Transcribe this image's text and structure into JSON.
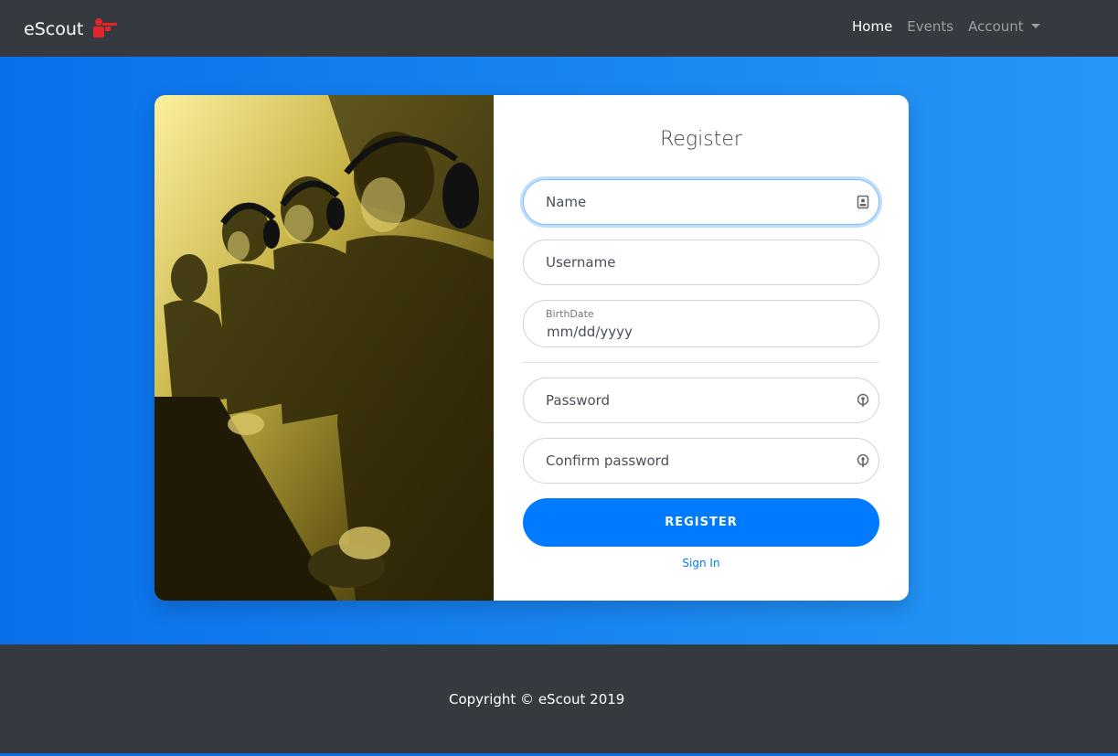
{
  "navbar": {
    "brand": "eScout",
    "links": [
      {
        "label": "Home"
      },
      {
        "label": "Events"
      },
      {
        "label": "Account"
      }
    ]
  },
  "form": {
    "title": "Register",
    "name_placeholder": "Name",
    "username_placeholder": "Username",
    "birthdate_label": "BirthDate",
    "birthdate_value": "mm/dd/yyyy",
    "password_placeholder": "Password",
    "confirm_placeholder": "Confirm password",
    "register_label": "REGISTER",
    "signin_label": "Sign In"
  },
  "footer": {
    "copyright": "Copyright © eScout 2019"
  },
  "colors": {
    "navbar_bg": "#343a40",
    "primary": "#007bff",
    "gradient_start": "#0a70ea",
    "gradient_end": "#2797f7",
    "logo_red": "#e0262b"
  },
  "icons": {
    "brand_logo": "gamer-icon",
    "name_field": "contact-card-icon",
    "password_field": "key-icon",
    "account_dropdown": "caret-down-icon"
  }
}
